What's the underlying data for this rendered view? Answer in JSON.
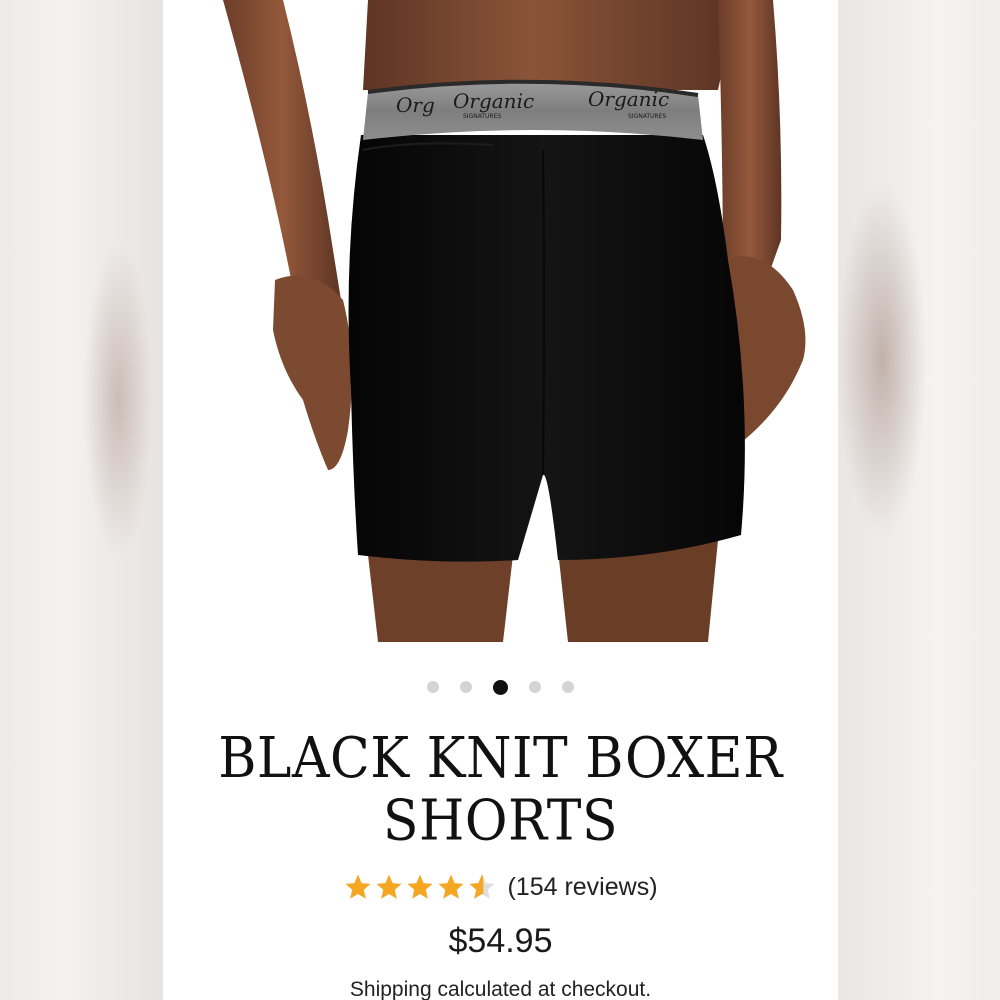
{
  "product": {
    "title_line1": "BLACK KNIT BOXER",
    "title_line2": "SHORTS",
    "rating_stars": 4.5,
    "reviews_text": "(154 reviews)",
    "price": "$54.95",
    "shipping": "Shipping calculated at checkout."
  },
  "carousel": {
    "total_slides": 5,
    "active_index": 2
  },
  "waistband": {
    "brand_script": "Organic",
    "brand_caption": "SIGNATURES"
  },
  "colors": {
    "star": "#f5a623",
    "star_empty": "#dedede",
    "dot_active": "#111111",
    "dot_inactive": "#d4d4d4",
    "shorts": "#0e0e0e",
    "waistband": "#8a8a8a",
    "skin": "#7a4a33"
  },
  "icons": {
    "star": "star-icon",
    "half_star": "half-star-icon"
  }
}
